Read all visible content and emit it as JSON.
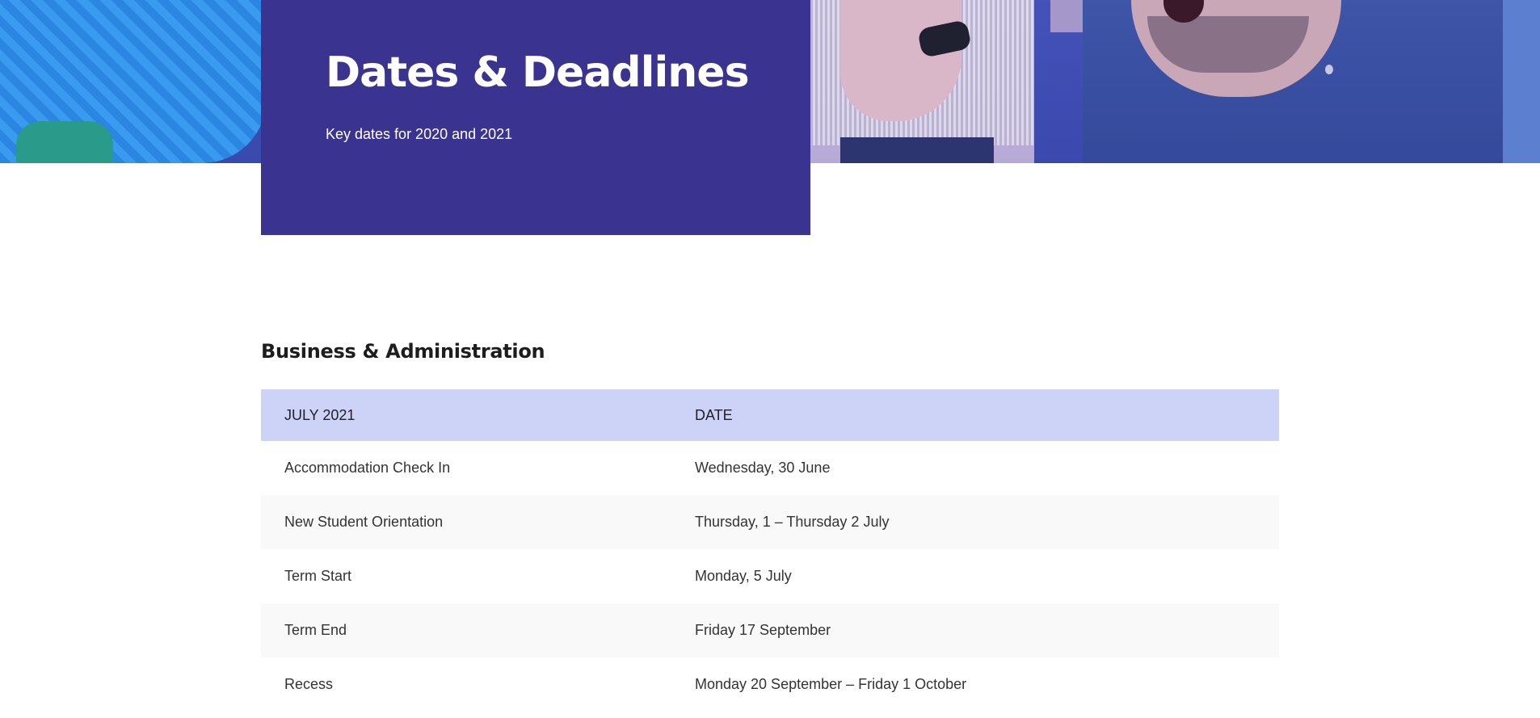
{
  "hero": {
    "title": "Dates & Deadlines",
    "subtitle": "Key dates for 2020 and 2021"
  },
  "section": {
    "heading": "Business & Administration"
  },
  "table": {
    "headers": {
      "event": "JULY 2021",
      "date": "DATE"
    },
    "rows": [
      {
        "event": "Accommodation Check In",
        "date": "Wednesday, 30 June"
      },
      {
        "event": "New Student Orientation",
        "date": "Thursday, 1 – Thursday 2 July"
      },
      {
        "event": "Term Start",
        "date": "Monday, 5 July"
      },
      {
        "event": "Term End",
        "date": "Friday 17 September"
      },
      {
        "event": "Recess",
        "date": "Monday 20 September – Friday 1 October"
      }
    ]
  },
  "colors": {
    "title_card_bg": "#3b3390",
    "table_header_bg": "#cdd3f7",
    "row_alt_bg": "#f9f9f9",
    "heading_text": "#1d1d1d"
  }
}
